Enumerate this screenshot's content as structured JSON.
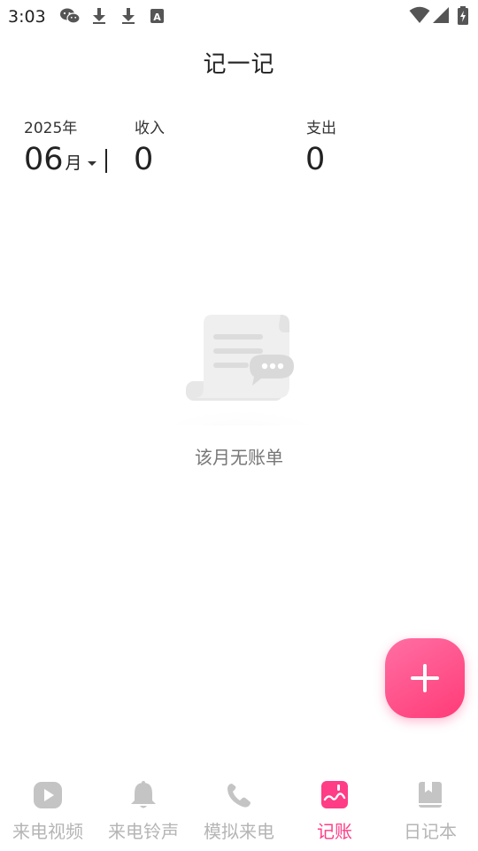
{
  "status_bar": {
    "time": "3:03",
    "left_icons": [
      "wechat-icon",
      "download-icon",
      "download-icon",
      "text-app-icon"
    ],
    "right_icons": [
      "wifi-icon",
      "signal-icon",
      "battery-charging-icon"
    ]
  },
  "header": {
    "title": "记一记"
  },
  "summary": {
    "year": "2025年",
    "month": "06",
    "month_unit": "月",
    "income_label": "收入",
    "income_value": "0",
    "expense_label": "支出",
    "expense_value": "0"
  },
  "empty_state": {
    "message": "该月无账单"
  },
  "fab": {
    "icon": "plus-icon"
  },
  "nav": {
    "items": [
      {
        "label": "来电视频",
        "icon": "play-icon",
        "active": false
      },
      {
        "label": "来电铃声",
        "icon": "bell-icon",
        "active": false
      },
      {
        "label": "模拟来电",
        "icon": "phone-icon",
        "active": false
      },
      {
        "label": "记账",
        "icon": "ledger-icon",
        "active": true
      },
      {
        "label": "日记本",
        "icon": "book-icon",
        "active": false
      }
    ]
  },
  "colors": {
    "accent": "#ff3c86",
    "inactive": "#b5b5b5",
    "text": "#222222"
  }
}
